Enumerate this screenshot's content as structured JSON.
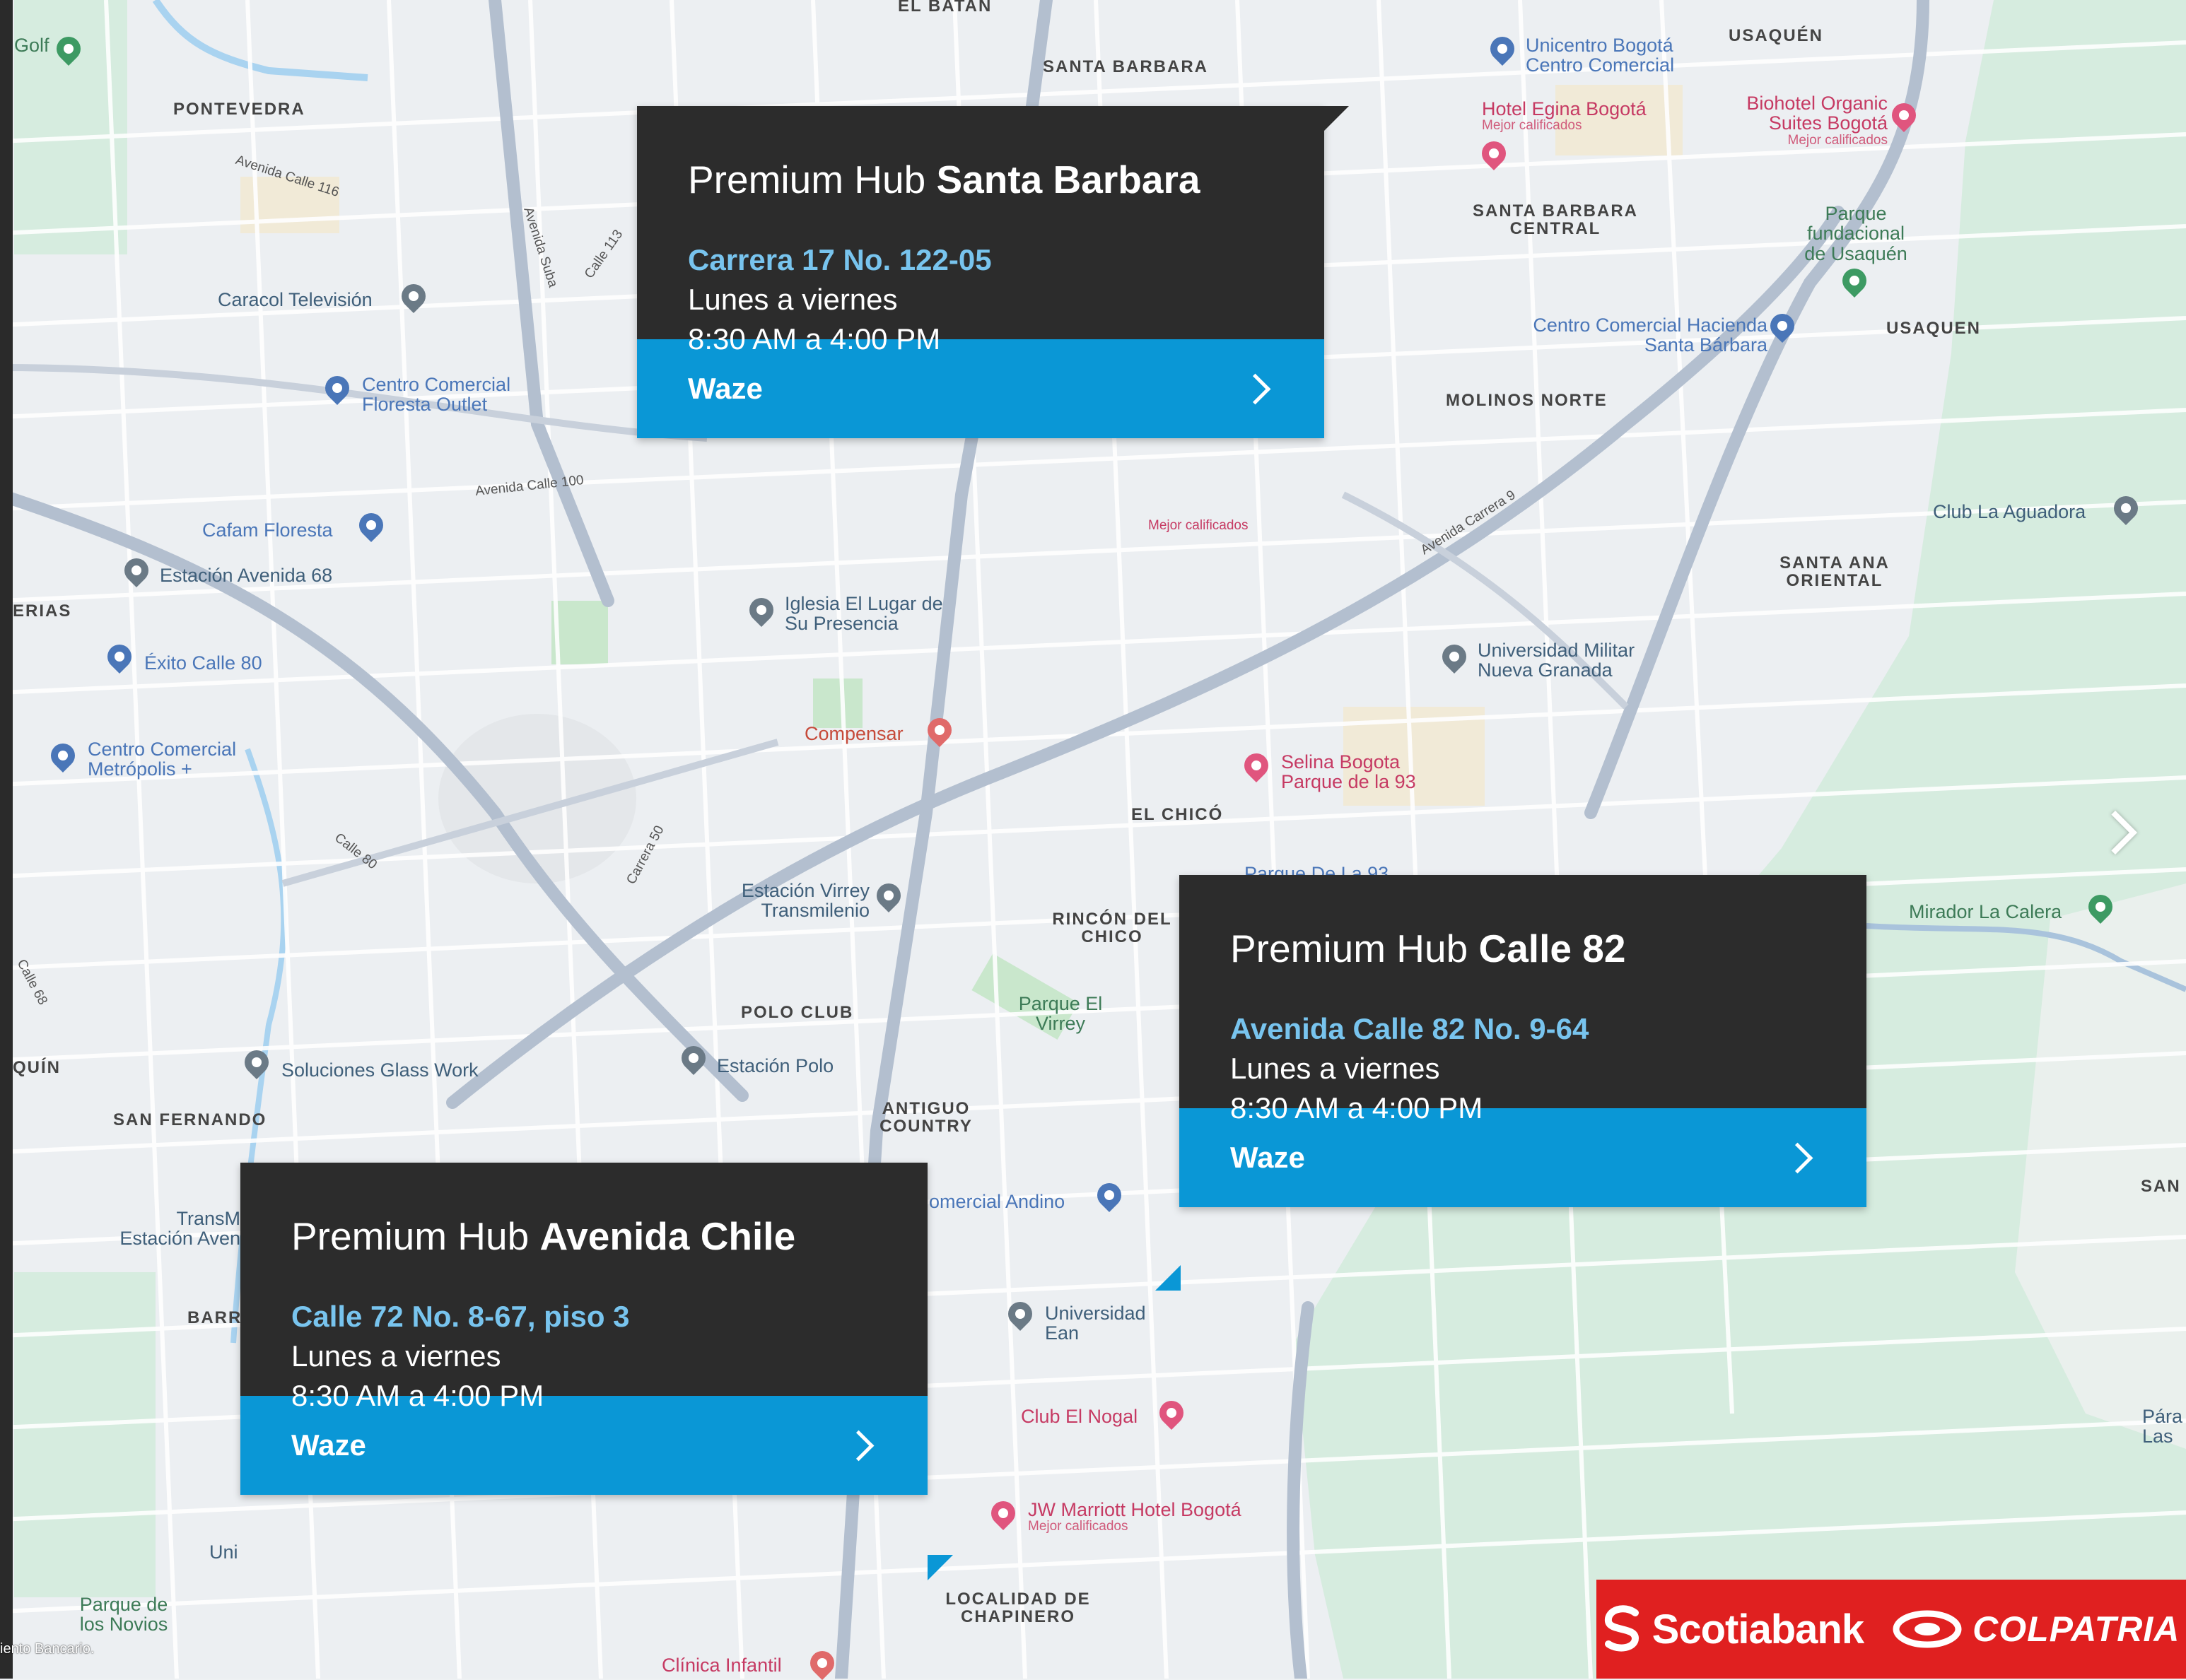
{
  "map": {
    "areas": [
      "EL BATAN",
      "SANTA BARBARA",
      "USAQUÉN",
      "PONTEVEDRA",
      "SANTA BARBARA CENTRAL",
      "USAQUEN",
      "MOLINOS NORTE",
      "SANTA ANA ORIENTAL",
      "ERIAS",
      "EL CHICÓ",
      "RINCÓN DEL CHICO",
      "POLO CLUB",
      "ANTIGUO COUNTRY",
      "SAN FERNANDO",
      "BARR",
      "LOCALIDAD DE CHAPINERO",
      "QUÍN",
      "SAN"
    ],
    "roads": [
      "Avenida Calle 116",
      "Avenida Suba",
      "Calle 113",
      "Avenida Calle 100",
      "Avenida Carrera 9",
      "Calle 80",
      "Carrera 50",
      "Calle 68"
    ],
    "places": {
      "golf": "Golf",
      "caracol": "Caracol Televisión",
      "floresta_outlet": "Centro Comercial Floresta Outlet",
      "cafam": "Cafam Floresta",
      "estacion68": "Estación Avenida 68",
      "exito": "Éxito Calle 80",
      "metropolis": "Centro Comercial Metrópolis +",
      "iglesia": "Iglesia El Lugar de Su Presencia",
      "compensar": "Compensar",
      "estacion_virrey": "Estación Virrey Transmilenio",
      "parque_virrey": "Parque El Virrey",
      "soluciones": "Soluciones Glass Work",
      "estacion_polo": "Estación Polo",
      "andino": "omercial Andino",
      "univ_ean": "Universidad Ean",
      "club_nogal": "Club El Nogal",
      "jw": "JW Marriott Hotel Bogotá",
      "jw_sub": "Mejor calificados",
      "clinica": "Clínica Infantil",
      "parque_novios": "Parque de los Novios",
      "transm": "TransM Estación Aven",
      "unicentro": "Unicentro Bogotá Centro Comercial",
      "hotel_egina": "Hotel Egina Bogotá",
      "hotel_egina_sub": "Mejor calificados",
      "biohotel": "Biohotel Organic Suites Bogotá",
      "biohotel_sub": "Mejor calificados",
      "parque_usaquen": "Parque fundacional de Usaquén",
      "hacienda": "Centro Comercial Hacienda Santa Bárbara",
      "club_aguadora": "Club La Aguadora",
      "univ_militar": "Universidad Militar Nueva Granada",
      "selina": "Selina Bogota Parque de la 93",
      "parque93": "Parque De La 93",
      "mirador": "Mirador La Calera",
      "mejor_cal": "Mejor calificados",
      "para": "Pára Las",
      "uni": "Uni"
    }
  },
  "hubs": [
    {
      "prefix": "Premium Hub",
      "name": "Santa Barbara",
      "address": "Carrera 17 No. 122-05",
      "days": "Lunes a viernes",
      "hours": "8:30 AM a 4:00 PM",
      "action": "Waze"
    },
    {
      "prefix": "Premium Hub",
      "name": "Calle 82",
      "address": "Avenida Calle 82 No. 9-64",
      "days": "Lunes a viernes",
      "hours": "8:30 AM a 4:00 PM",
      "action": "Waze"
    },
    {
      "prefix": "Premium Hub",
      "name": "Avenida Chile",
      "address": "Calle 72 No. 8-67, piso 3",
      "days": "Lunes a viernes",
      "hours": "8:30 AM a 4:00 PM",
      "action": "Waze"
    }
  ],
  "brand": {
    "primary": "Scotiabank",
    "secondary": "COLPATRIA",
    "color": "#e02020"
  },
  "footnote": "iento Bancario."
}
